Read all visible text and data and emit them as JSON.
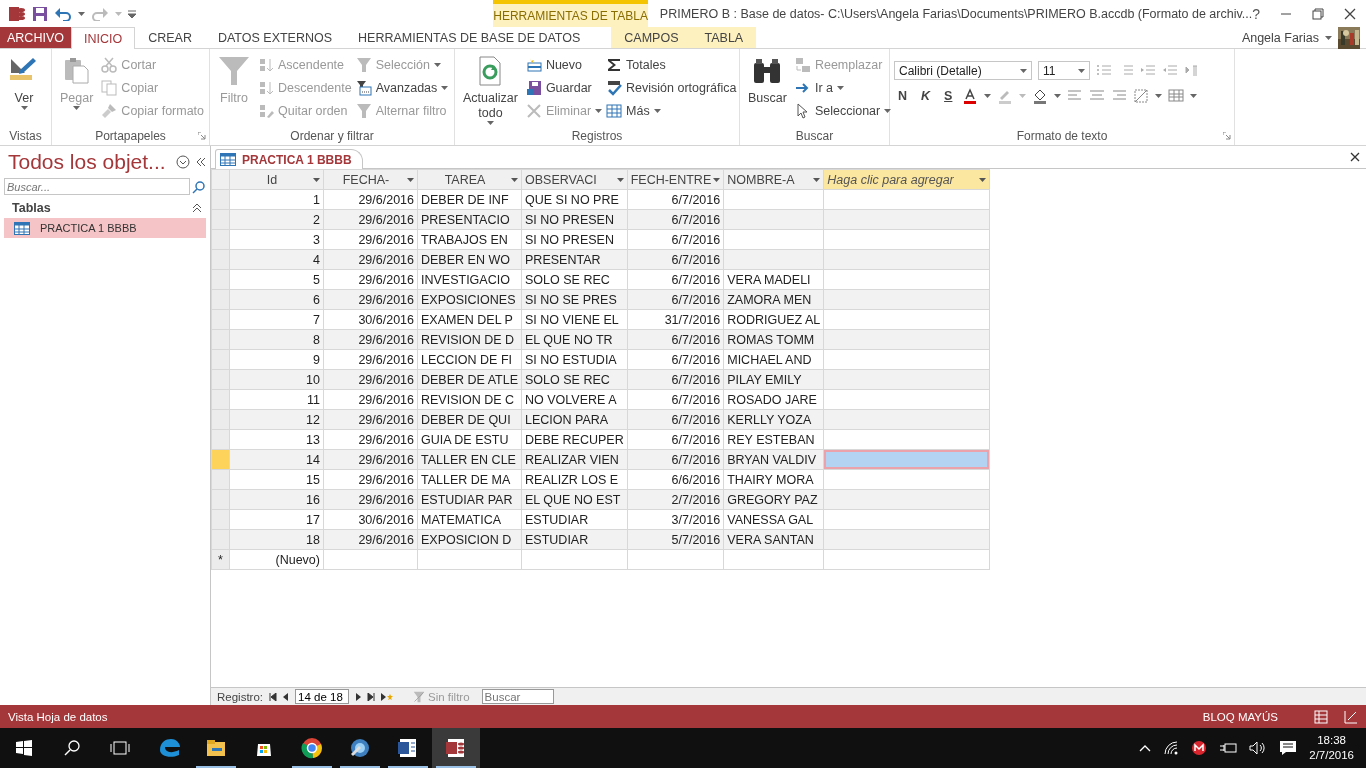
{
  "title_bar": {
    "title": "PRIMERO B : Base de datos- C:\\Users\\Angela Farias\\Documents\\PRIMERO B.accdb (Formato de archiv...",
    "context_group": "HERRAMIENTAS DE TABLA",
    "help": "?"
  },
  "tabs": [
    {
      "label": "ARCHIVO",
      "kind": "file",
      "selected": false,
      "contextual": false
    },
    {
      "label": "INICIO",
      "kind": "tab",
      "selected": true,
      "contextual": false
    },
    {
      "label": "CREAR",
      "kind": "tab",
      "selected": false,
      "contextual": false
    },
    {
      "label": "DATOS EXTERNOS",
      "kind": "tab",
      "selected": false,
      "contextual": false
    },
    {
      "label": "HERRAMIENTAS DE BASE DE DATOS",
      "kind": "tab",
      "selected": false,
      "contextual": false
    },
    {
      "label": "CAMPOS",
      "kind": "tab",
      "selected": false,
      "contextual": true
    },
    {
      "label": "TABLA",
      "kind": "tab",
      "selected": false,
      "contextual": true
    }
  ],
  "user": {
    "name": "Angela Farias"
  },
  "ribbon": [
    {
      "label": "Vistas",
      "launcher": false,
      "items": [
        {
          "kind": "large",
          "label": "Ver",
          "disabled": false,
          "dropdown": true
        }
      ]
    },
    {
      "label": "Portapapeles",
      "launcher": true,
      "items": [
        {
          "kind": "large",
          "label": "Pegar",
          "disabled": true,
          "dropdown": true
        },
        {
          "kind": "column",
          "items": [
            {
              "label": "Cortar",
              "disabled": true,
              "dropdown": false
            },
            {
              "label": "Copiar",
              "disabled": true,
              "dropdown": false
            },
            {
              "label": "Copiar formato",
              "disabled": true,
              "dropdown": false
            }
          ]
        }
      ]
    },
    {
      "label": "Ordenar y filtrar",
      "launcher": false,
      "items": [
        {
          "kind": "large",
          "label": "Filtro",
          "disabled": true,
          "dropdown": false
        },
        {
          "kind": "column",
          "items": [
            {
              "label": "Ascendente",
              "disabled": true,
              "dropdown": false
            },
            {
              "label": "Descendente",
              "disabled": true,
              "dropdown": false
            },
            {
              "label": "Quitar orden",
              "disabled": true,
              "dropdown": false
            }
          ]
        },
        {
          "kind": "column",
          "items": [
            {
              "label": "Selección",
              "disabled": true,
              "dropdown": true
            },
            {
              "label": "Avanzadas",
              "disabled": false,
              "dropdown": true
            },
            {
              "label": "Alternar filtro",
              "disabled": true,
              "dropdown": false
            }
          ]
        }
      ]
    },
    {
      "label": "Registros",
      "launcher": false,
      "items": [
        {
          "kind": "large",
          "label": "Actualizar todo",
          "disabled": false,
          "dropdown": true
        },
        {
          "kind": "column",
          "items": [
            {
              "label": "Nuevo",
              "disabled": false,
              "dropdown": false
            },
            {
              "label": "Guardar",
              "disabled": false,
              "dropdown": false
            },
            {
              "label": "Eliminar",
              "disabled": true,
              "dropdown": true
            }
          ]
        },
        {
          "kind": "column",
          "items": [
            {
              "label": "Totales",
              "disabled": false,
              "dropdown": false
            },
            {
              "label": "Revisión ortográfica",
              "disabled": false,
              "dropdown": false
            },
            {
              "label": "Más",
              "disabled": false,
              "dropdown": true
            }
          ]
        }
      ]
    },
    {
      "label": "Buscar",
      "launcher": false,
      "items": [
        {
          "kind": "large",
          "label": "Buscar",
          "disabled": false,
          "dropdown": false
        },
        {
          "kind": "column",
          "items": [
            {
              "label": "Reemplazar",
              "disabled": true,
              "dropdown": false
            },
            {
              "label": "Ir a",
              "disabled": false,
              "dropdown": true
            },
            {
              "label": "Seleccionar",
              "disabled": false,
              "dropdown": true
            }
          ]
        }
      ]
    },
    {
      "label": "Formato de texto",
      "launcher": true,
      "items": [
        {
          "kind": "font",
          "font": "Calibri (Detalle)",
          "size": "11",
          "bold": "N",
          "italic": "K",
          "underline": "S"
        }
      ]
    }
  ],
  "nav_pane": {
    "title": "Todos los objet...",
    "search": {
      "placeholder": "Buscar..."
    },
    "section": "Tablas",
    "items": [
      {
        "label": "PRACTICA 1 BBBB",
        "selected": true
      }
    ]
  },
  "document_tab": {
    "label": "PRACTICA 1 BBBB"
  },
  "table": {
    "columns": [
      {
        "label": "Id",
        "new_field": false
      },
      {
        "label": "FECHA-",
        "new_field": false
      },
      {
        "label": "TAREA",
        "new_field": false
      },
      {
        "label": "OBSERVACI",
        "new_field": false
      },
      {
        "label": "FECH-ENTRE",
        "new_field": false
      },
      {
        "label": "NOMBRE-A",
        "new_field": false
      },
      {
        "label": "Haga clic para agregar",
        "new_field": true
      }
    ],
    "rows": [
      {
        "cells": [
          "1",
          "29/6/2016",
          "DEBER DE INF",
          "QUE SI NO PRE",
          "6/7/2016",
          ""
        ],
        "selected": false
      },
      {
        "cells": [
          "2",
          "29/6/2016",
          "PRESENTACIO",
          "SI NO PRESEN",
          "6/7/2016",
          ""
        ],
        "selected": false
      },
      {
        "cells": [
          "3",
          "29/6/2016",
          "TRABAJOS EN",
          "SI NO PRESEN",
          "6/7/2016",
          ""
        ],
        "selected": false
      },
      {
        "cells": [
          "4",
          "29/6/2016",
          "DEBER EN WO",
          "PRESENTAR",
          "6/7/2016",
          ""
        ],
        "selected": false
      },
      {
        "cells": [
          "5",
          "29/6/2016",
          "INVESTIGACIO",
          "SOLO SE REC",
          "6/7/2016",
          "VERA MADELI"
        ],
        "selected": false
      },
      {
        "cells": [
          "6",
          "29/6/2016",
          "EXPOSICIONES",
          "SI NO SE PRES",
          "6/7/2016",
          "ZAMORA MEN"
        ],
        "selected": false
      },
      {
        "cells": [
          "7",
          "30/6/2016",
          "EXAMEN DEL P",
          "SI NO VIENE EL",
          "31/7/2016",
          "RODRIGUEZ AL"
        ],
        "selected": false
      },
      {
        "cells": [
          "8",
          "29/6/2016",
          "REVISION DE D",
          "EL QUE NO TR",
          "6/7/2016",
          "ROMAS TOMM"
        ],
        "selected": false
      },
      {
        "cells": [
          "9",
          "29/6/2016",
          "LECCION DE FI",
          "SI NO ESTUDIA",
          "6/7/2016",
          "MICHAEL AND"
        ],
        "selected": false
      },
      {
        "cells": [
          "10",
          "29/6/2016",
          "DEBER DE ATLE",
          "SOLO SE REC",
          "6/7/2016",
          "PILAY EMILY"
        ],
        "selected": false
      },
      {
        "cells": [
          "11",
          "29/6/2016",
          "REVISION DE C",
          "NO VOLVERE A",
          "6/7/2016",
          "ROSADO JARE"
        ],
        "selected": false
      },
      {
        "cells": [
          "12",
          "29/6/2016",
          "DEBER DE QUI",
          "LECION PARA",
          "6/7/2016",
          "KERLLY YOZA"
        ],
        "selected": false
      },
      {
        "cells": [
          "13",
          "29/6/2016",
          "GUIA DE ESTU",
          "DEBE RECUPER",
          "6/7/2016",
          "REY ESTEBAN"
        ],
        "selected": false
      },
      {
        "cells": [
          "14",
          "29/6/2016",
          "TALLER EN CLE",
          "REALIZAR VIEN",
          "6/7/2016",
          "BRYAN VALDIV"
        ],
        "selected": true
      },
      {
        "cells": [
          "15",
          "29/6/2016",
          "TALLER DE MA",
          "REALIZR LOS E",
          "6/6/2016",
          "THAIRY MORA"
        ],
        "selected": false
      },
      {
        "cells": [
          "16",
          "29/6/2016",
          "ESTUDIAR PAR",
          "EL QUE NO EST",
          "2/7/2016",
          "GREGORY PAZ"
        ],
        "selected": false
      },
      {
        "cells": [
          "17",
          "30/6/2016",
          "MATEMATICA",
          "ESTUDIAR",
          "3/7/2016",
          "VANESSA GAL"
        ],
        "selected": false
      },
      {
        "cells": [
          "18",
          "29/6/2016",
          "EXPOSICION D",
          "ESTUDIAR",
          "5/7/2016",
          "VERA SANTAN"
        ],
        "selected": false
      }
    ],
    "new_row": {
      "marker": "*",
      "label": "(Nuevo)"
    }
  },
  "record_nav": {
    "label": "Registro:",
    "position": "14 de 18",
    "filter": "Sin filtro",
    "search": {
      "placeholder": "Buscar"
    }
  },
  "status_bar": {
    "view": "Vista Hoja de datos",
    "caps_lock": "BLOQ MAYÚS"
  },
  "taskbar": {
    "apps": [
      {
        "running": false,
        "selected": false
      },
      {
        "running": true,
        "selected": false
      },
      {
        "running": false,
        "selected": false
      },
      {
        "running": true,
        "selected": false
      },
      {
        "running": true,
        "selected": false
      },
      {
        "running": true,
        "selected": false
      },
      {
        "running": true,
        "selected": true
      }
    ],
    "time": "18:38",
    "date": "2/7/2016"
  }
}
